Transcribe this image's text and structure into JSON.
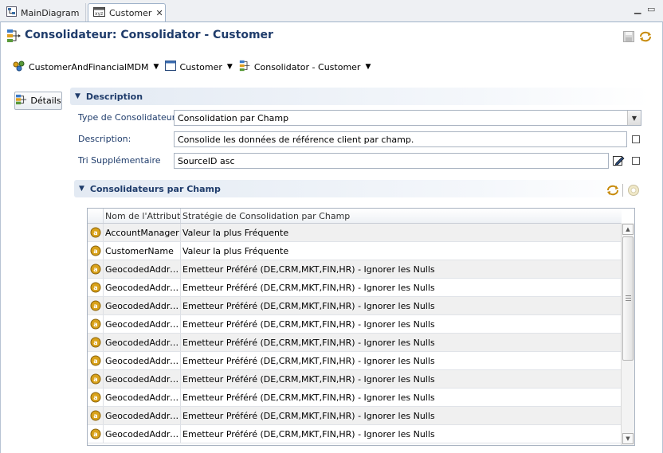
{
  "tabs": [
    {
      "label": "MainDiagram",
      "icon": "diagram-icon"
    },
    {
      "label": "Customer",
      "icon": "entity-tab-icon",
      "active": true
    }
  ],
  "page": {
    "title": "Consolidateur: Consolidator - Customer"
  },
  "breadcrumb": [
    {
      "label": "CustomerAndFinancialMDM",
      "icon": "model-icon"
    },
    {
      "label": "Customer",
      "icon": "entity-icon"
    },
    {
      "label": "Consolidator - Customer",
      "icon": "consolidator-icon"
    }
  ],
  "details_button": {
    "label": "Détails"
  },
  "description_section": {
    "title": "Description",
    "type_label": "Type de Consolidateur:",
    "type_value": "Consolidation par Champ",
    "description_label": "Description:",
    "description_value": "Consolide les données de référence client par champ.",
    "sort_label": "Tri Supplémentaire",
    "sort_value": "SourceID asc"
  },
  "fields_section": {
    "title": "Consolidateurs par Champ",
    "columns": [
      "Nom de l'Attribut",
      "Stratégie de Consolidation par Champ"
    ],
    "rows": [
      [
        "AccountManager",
        "Valeur la plus Fréquente"
      ],
      [
        "CustomerName",
        "Valeur la plus Fréquente"
      ],
      [
        "GeocodedAddres...",
        "Emetteur Préféré (DE,CRM,MKT,FIN,HR) - Ignorer les Nulls"
      ],
      [
        "GeocodedAddres...",
        "Emetteur Préféré (DE,CRM,MKT,FIN,HR) - Ignorer les Nulls"
      ],
      [
        "GeocodedAddres...",
        "Emetteur Préféré (DE,CRM,MKT,FIN,HR) - Ignorer les Nulls"
      ],
      [
        "GeocodedAddres...",
        "Emetteur Préféré (DE,CRM,MKT,FIN,HR) - Ignorer les Nulls"
      ],
      [
        "GeocodedAddres...",
        "Emetteur Préféré (DE,CRM,MKT,FIN,HR) - Ignorer les Nulls"
      ],
      [
        "GeocodedAddres...",
        "Emetteur Préféré (DE,CRM,MKT,FIN,HR) - Ignorer les Nulls"
      ],
      [
        "GeocodedAddres...",
        "Emetteur Préféré (DE,CRM,MKT,FIN,HR) - Ignorer les Nulls"
      ],
      [
        "GeocodedAddres...",
        "Emetteur Préféré (DE,CRM,MKT,FIN,HR) - Ignorer les Nulls"
      ],
      [
        "GeocodedAddres...",
        "Emetteur Préféré (DE,CRM,MKT,FIN,HR) - Ignorer les Nulls"
      ],
      [
        "GeocodedAddres...",
        "Emetteur Préféré (DE,CRM,MKT,FIN,HR) - Ignorer les Nulls"
      ]
    ]
  },
  "colors": {
    "title_blue": "#1f3c6b",
    "section_bg": "#e3eaf3",
    "attribute_icon": "#d9a21b",
    "border": "#a9b3c1"
  }
}
